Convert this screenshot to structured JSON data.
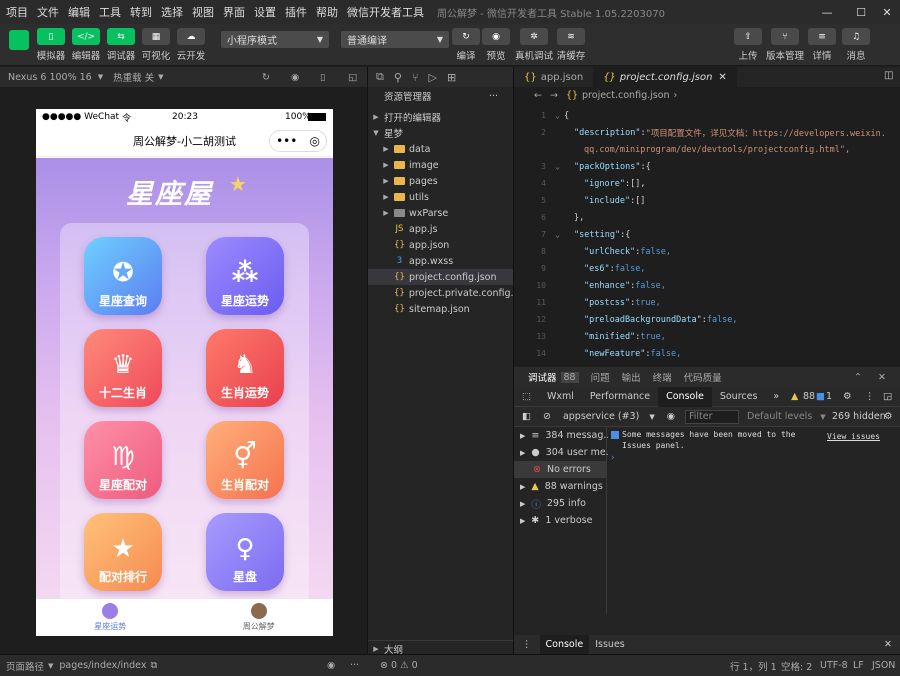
{
  "menubar": {
    "items": [
      "项目",
      "文件",
      "编辑",
      "工具",
      "转到",
      "选择",
      "视图",
      "界面",
      "设置",
      "插件",
      "帮助",
      "微信开发者工具"
    ],
    "window_title": "周公解梦 - 微信开发者工具 Stable 1.05.2203070"
  },
  "toolbar": {
    "simulator": "模拟器",
    "editor": "编辑器",
    "debugger": "调试器",
    "visual": "可视化",
    "cloud": "云开发",
    "mode_select": "小程序模式",
    "compile_select": "普通编译",
    "compile": "编译",
    "preview": "预览",
    "real_debug": "真机调试",
    "clear_cache": "清缓存",
    "upload": "上传",
    "version": "版本管理",
    "details": "详情",
    "messages": "消息"
  },
  "simbar": {
    "device": "Nexus 6 100% 16",
    "hotreload": "热重载 关"
  },
  "phone": {
    "carrier": "●●●●● WeChat",
    "wifi": "令",
    "time": "20:23",
    "battery": "100%",
    "nav_title": "周公解梦-小二胡测试",
    "logo": "星座屋",
    "tiles": [
      {
        "label": "星座查询",
        "icon": "✪"
      },
      {
        "label": "星座运势",
        "icon": "⁂"
      },
      {
        "label": "十二生肖",
        "icon": "♛"
      },
      {
        "label": "生肖运势",
        "icon": "♞"
      },
      {
        "label": "星座配对",
        "icon": "♍"
      },
      {
        "label": "生肖配对",
        "icon": "⚥"
      },
      {
        "label": "配对排行",
        "icon": "★"
      },
      {
        "label": "星盘",
        "icon": "♀"
      }
    ],
    "tabs": [
      {
        "label": "星座运势"
      },
      {
        "label": "周公解梦"
      }
    ]
  },
  "explorer": {
    "title": "资源管理器",
    "open_editors": "打开的编辑器",
    "project": "星梦",
    "outline": "大纲",
    "status": "⊗ 0 ⚠ 0",
    "folders": [
      {
        "name": "data"
      },
      {
        "name": "image"
      },
      {
        "name": "pages"
      },
      {
        "name": "utils"
      },
      {
        "name": "wxParse"
      }
    ],
    "files": [
      {
        "name": "app.js",
        "icon": "JS"
      },
      {
        "name": "app.json",
        "icon": "{}"
      },
      {
        "name": "app.wxss",
        "icon": "3"
      },
      {
        "name": "project.config.json",
        "icon": "{}"
      },
      {
        "name": "project.private.config.js...",
        "icon": "{}"
      },
      {
        "name": "sitemap.json",
        "icon": "{}"
      }
    ]
  },
  "editor": {
    "tabs": [
      {
        "label": "app.json",
        "icon": "{}"
      },
      {
        "label": "project.config.json",
        "icon": "{}"
      }
    ],
    "breadcrumb": "project.config.json",
    "lines": [
      {
        "n": "1",
        "k": "",
        "v": "{"
      },
      {
        "n": "2",
        "k": "\"description\"",
        "v": "\"项目配置文件，详见文档：https://developers.weixin."
      },
      {
        "n": "",
        "k": "",
        "v": "qq.com/miniprogram/dev/devtools/projectconfig.html\","
      },
      {
        "n": "3",
        "k": "\"packOptions\"",
        "v": "{"
      },
      {
        "n": "4",
        "k": "\"ignore\"",
        "v": "[],"
      },
      {
        "n": "5",
        "k": "\"include\"",
        "v": "[]"
      },
      {
        "n": "6",
        "k": "",
        "v": "},"
      },
      {
        "n": "7",
        "k": "\"setting\"",
        "v": "{"
      },
      {
        "n": "8",
        "k": "\"urlCheck\"",
        "v": "false,"
      },
      {
        "n": "9",
        "k": "\"es6\"",
        "v": "false,"
      },
      {
        "n": "10",
        "k": "\"enhance\"",
        "v": "false,"
      },
      {
        "n": "11",
        "k": "\"postcss\"",
        "v": "true,"
      },
      {
        "n": "12",
        "k": "\"preloadBackgroundData\"",
        "v": "false,"
      },
      {
        "n": "13",
        "k": "\"minified\"",
        "v": "true,"
      },
      {
        "n": "14",
        "k": "\"newFeature\"",
        "v": "false,"
      }
    ]
  },
  "devtools": {
    "tabs": [
      "调试器",
      "88",
      "问题",
      "输出",
      "终端",
      "代码质量"
    ],
    "subtabs": [
      "Wxml",
      "Performance",
      "Console",
      "Sources"
    ],
    "warn_count": "88",
    "info_count": "1",
    "context": "appservice (#3)",
    "filter": "Filter",
    "levels": "Default levels",
    "hidden": "269 hidden",
    "side": [
      {
        "icon": "≡",
        "label": "384 messag..."
      },
      {
        "icon": "●",
        "label": "304 user me..."
      },
      {
        "icon": "⊗",
        "label": "No errors"
      },
      {
        "icon": "▲",
        "label": "88 warnings"
      },
      {
        "icon": "ⓘ",
        "label": "295 info"
      },
      {
        "icon": "✱",
        "label": "1 verbose"
      }
    ],
    "message": "Some messages have been moved to the Issues panel.",
    "view_issues": "View issues",
    "bottom_tabs": [
      "Console",
      "Issues"
    ]
  },
  "status": {
    "page_path_label": "页面路径",
    "page_path": "pages/index/index",
    "cursor": "行 1，列 1",
    "spaces": "空格: 2",
    "encoding": "UTF-8",
    "eol": "LF",
    "lang": "JSON"
  }
}
